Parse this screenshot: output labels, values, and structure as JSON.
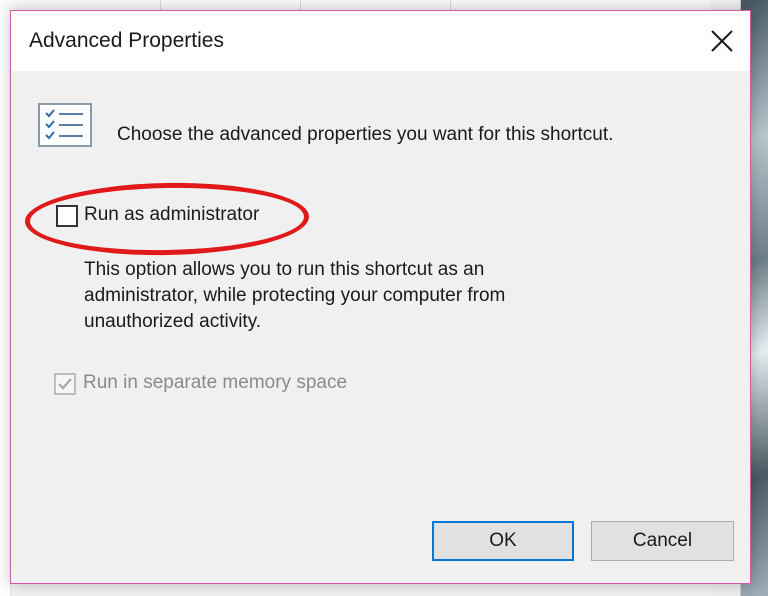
{
  "dialog": {
    "title": "Advanced Properties",
    "intro": "Choose the advanced properties you want for this shortcut.",
    "run_as_admin": {
      "label": "Run as administrator",
      "checked": false
    },
    "description_lines": [
      "This option allows you to run this shortcut as an",
      "administrator, while protecting your computer from",
      "unauthorized activity."
    ],
    "separate_memory": {
      "label": "Run in separate memory space",
      "checked": true,
      "disabled": true
    },
    "buttons": {
      "ok": "OK",
      "cancel": "Cancel"
    }
  },
  "icons": {
    "close": "close-icon",
    "properties": "properties-list-icon",
    "checkmark": "checkmark-icon"
  },
  "colors": {
    "highlight": "#e01a1a",
    "focus_border": "#0078d7",
    "dialog_border": "#d45aa7"
  }
}
